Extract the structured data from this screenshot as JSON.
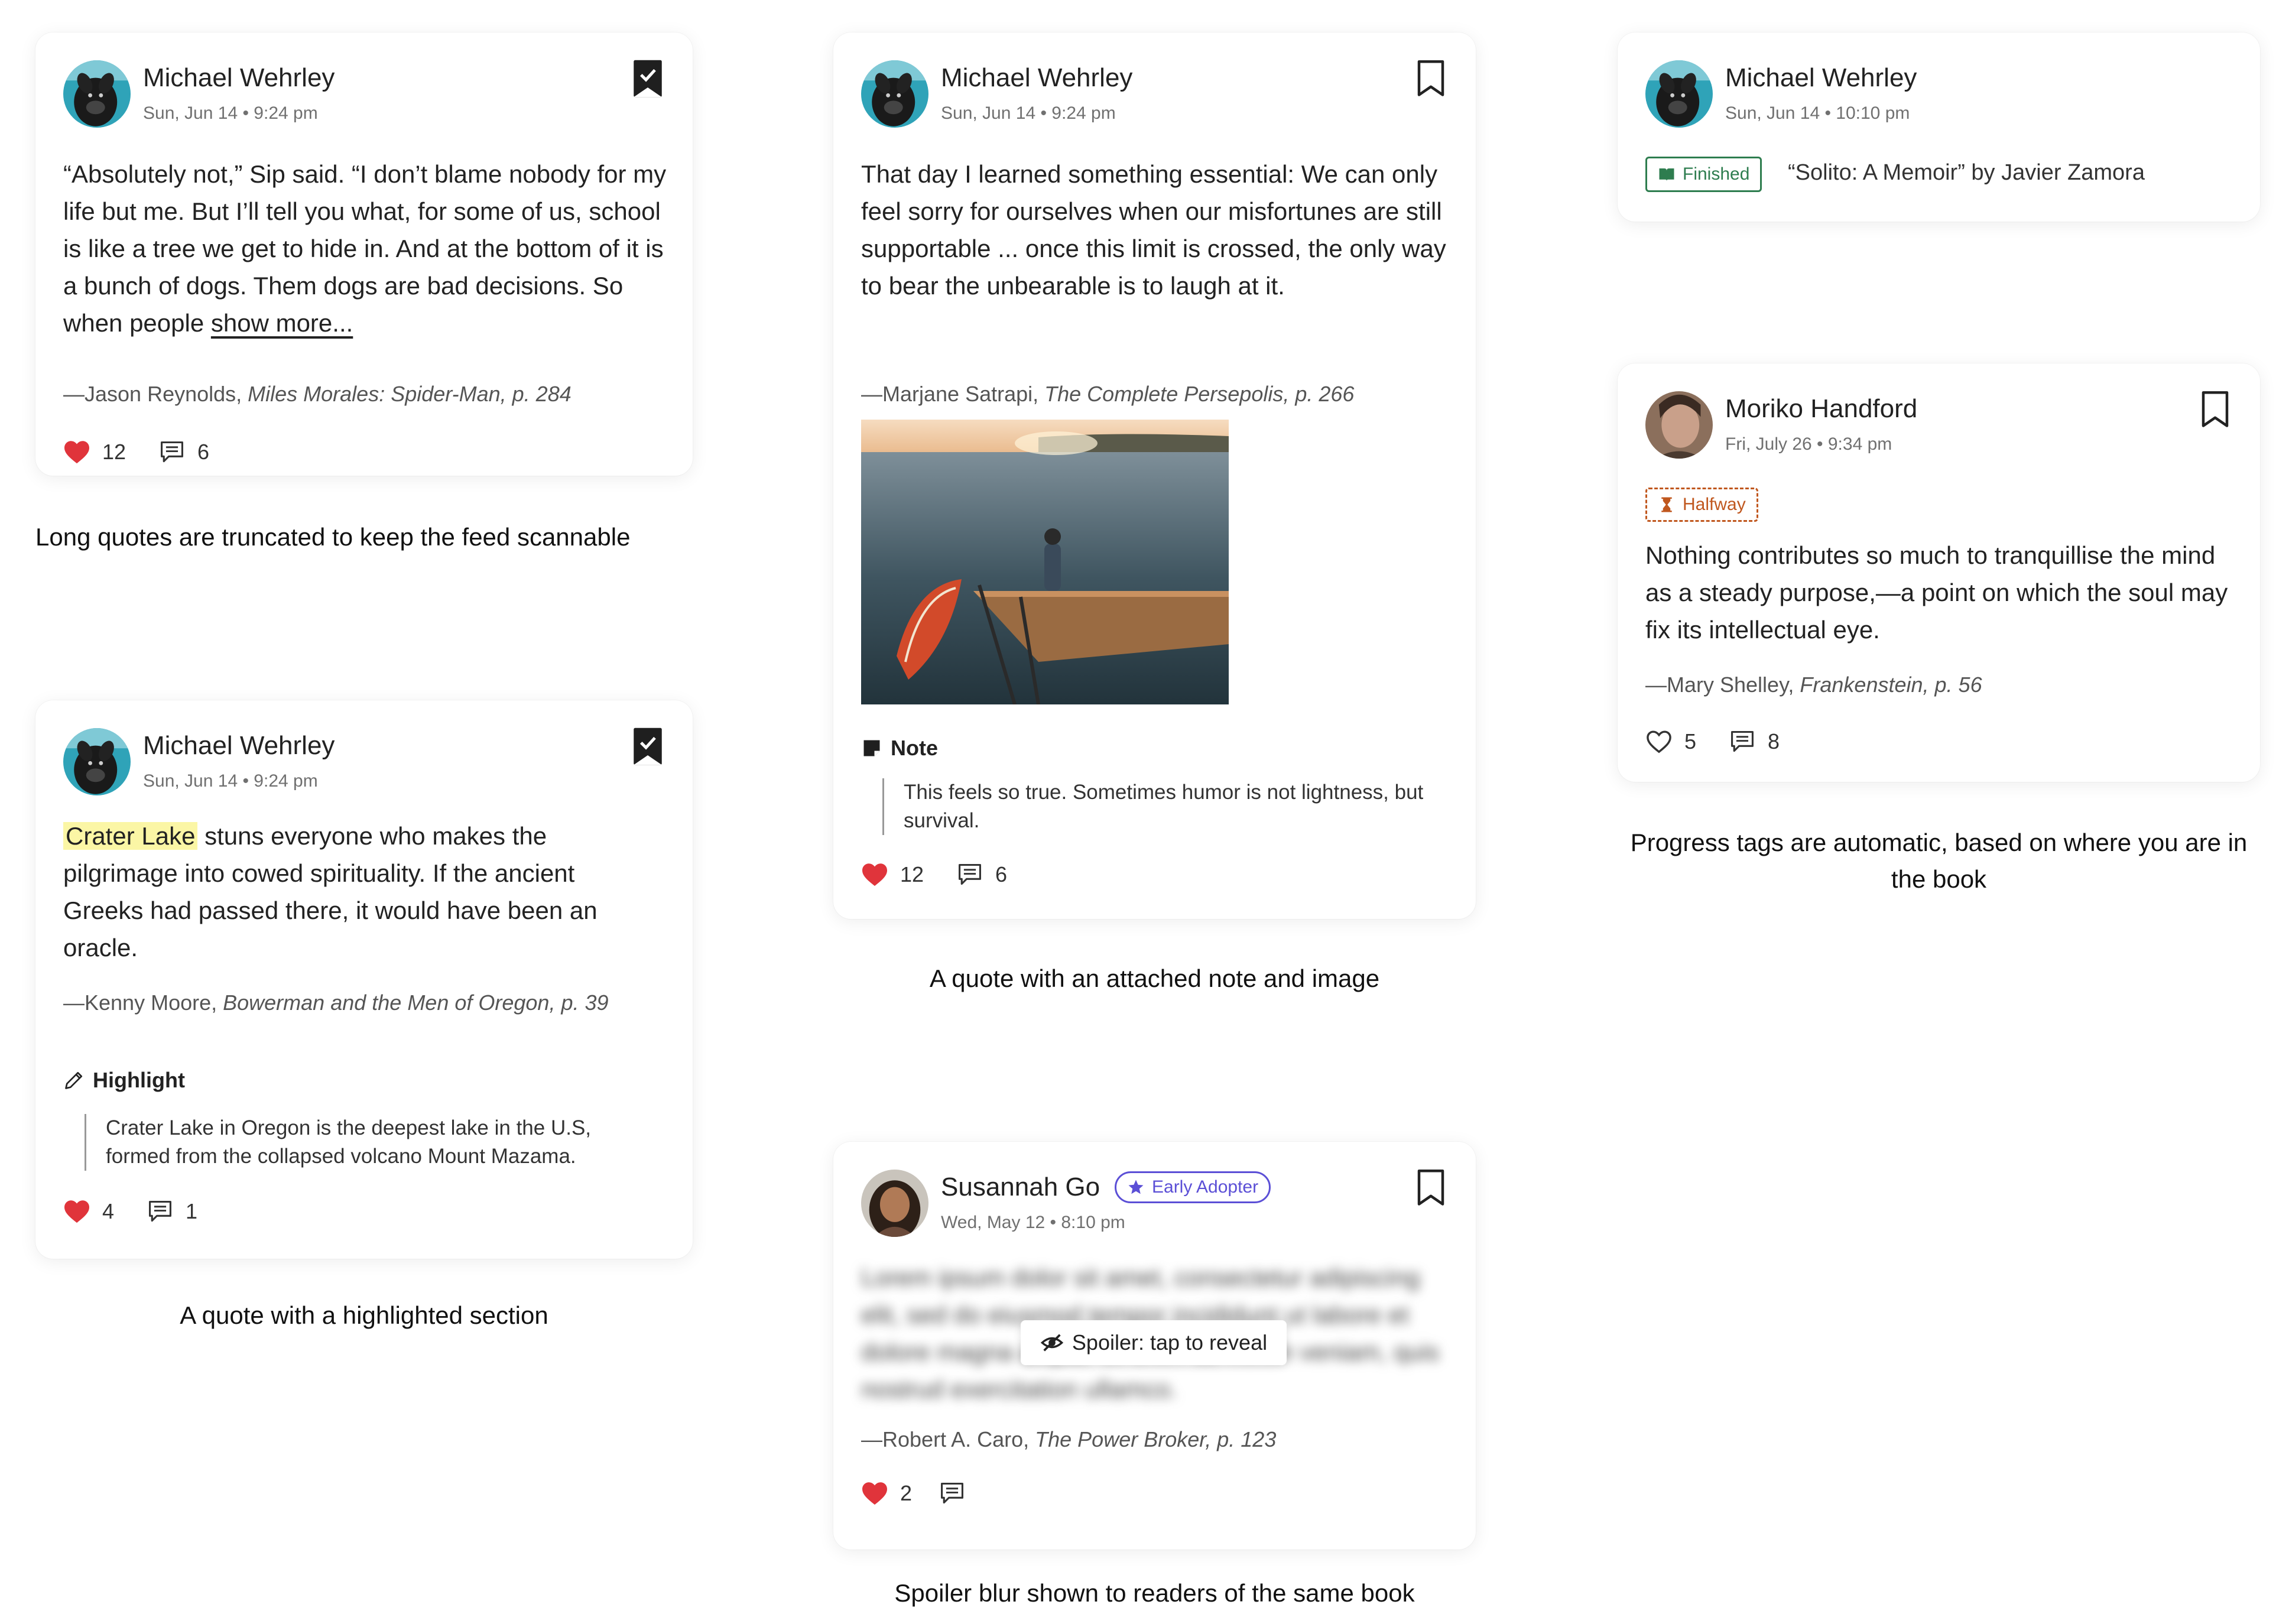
{
  "accent": {
    "heart": "#e0343b",
    "finished": "#2e7d4f",
    "halfway": "#c0571e",
    "early_adopter": "#5b4fd6",
    "highlight": "#fbf6a5"
  },
  "cards": {
    "c1": {
      "name": "Michael Wehrley",
      "date": "Sun, Jun 14 • 9:24 pm",
      "bookmark": "bookmarked",
      "body_text": "“Absolutely not,” Sip said. “I don’t blame nobody for my life but me. But I’ll tell you what, for some of us, school is like a tree we get to hide in. And at the bottom of it is a bunch of dogs. Them dogs are bad decisions. So when people ",
      "show_more": "show more...",
      "attr_author": "—Jason Reynolds, ",
      "attr_book": "Miles Morales: Spider-Man, p. 284",
      "likes": "12",
      "comments": "6"
    },
    "c2": {
      "name": "Michael Wehrley",
      "date": "Sun, Jun 14 • 9:24 pm",
      "bookmark": "bookmarked",
      "highlight_word": "Crater Lake",
      "body_rest": " stuns everyone who makes the pilgrimage into cowed spirituality. If the ancient Greeks had passed there, it would have been an oracle.",
      "attr_author": "—Kenny Moore, ",
      "attr_book": "Bowerman and the Men of Oregon, p. 39",
      "section_label": "Highlight",
      "section_text": "Crater Lake in Oregon is the deepest lake in the U.S, formed from the collapsed volcano Mount Mazama.",
      "likes": "4",
      "comments": "1"
    },
    "c3": {
      "name": "Michael Wehrley",
      "date": "Sun, Jun 14 • 9:24 pm",
      "bookmark": "not-bookmarked",
      "body_text": "That day I learned something essential: We can only feel sorry for ourselves when our misfortunes are still supportable ... once this limit is crossed, the only way to bear the unbearable is to laugh at it.",
      "attr_author": "—Marjane Satrapi, ",
      "attr_book": "The Complete Persepolis, p. 266",
      "section_label": "Note",
      "section_text": "This feels so true. Sometimes humor is not lightness, but survival.",
      "likes": "12",
      "comments": "6"
    },
    "c4": {
      "name": "Susannah Go",
      "badge": "Early Adopter",
      "date": "Wed, May 12 • 8:10 pm",
      "bookmark": "not-bookmarked",
      "blurred_text": "Lorem ipsum dolor sit amet, consectetur adipiscing elit, sed do eiusmod tempor incididunt ut labore et dolore magna aliqua. Ut enim ad minim veniam, quis nostrud exercitation ullamco.",
      "spoiler_label": "Spoiler: tap to reveal",
      "attr_author": "—Robert A. Caro, ",
      "attr_book": "The Power Broker, p. 123",
      "likes": "2"
    },
    "c5": {
      "name": "Michael Wehrley",
      "date": "Sun, Jun 14 • 10:10 pm",
      "tag": "Finished",
      "book": "“Solito: A Memoir” by Javier Zamora"
    },
    "c6": {
      "name": "Moriko Handford",
      "date": "Fri, July 26 • 9:34 pm",
      "bookmark": "not-bookmarked",
      "tag": "Halfway",
      "body_text": "Nothing contributes so much to tranquillise the mind as a steady purpose,—a point on which the soul may fix its intellectual eye.",
      "attr_author": "—Mary Shelley, ",
      "attr_book": "Frankenstein, p. 56",
      "likes": "5",
      "comments": "8"
    }
  },
  "captions": {
    "c1": "Long quotes are truncated to keep the feed scannable",
    "c2": "A quote with a highlighted section",
    "c3": "A quote with an attached note and image",
    "c4": "Spoiler blur shown to readers of the same book",
    "c6": "Progress tags are automatic, based on where you are in the book"
  }
}
